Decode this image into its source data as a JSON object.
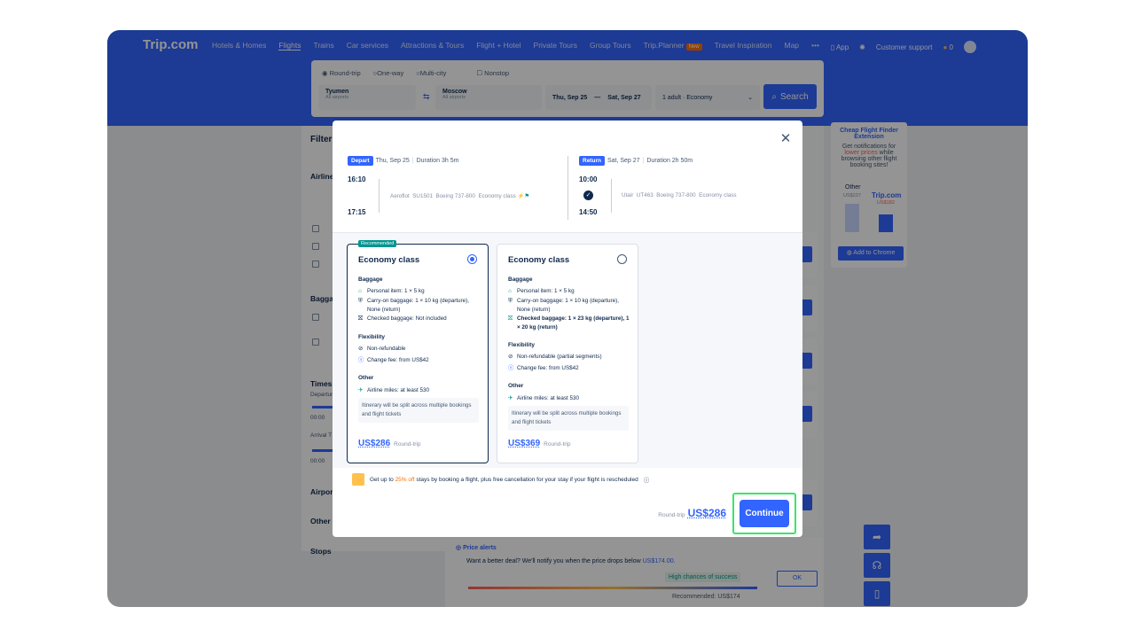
{
  "header": {
    "logo": "Trip.com",
    "nav": [
      "Hotels & Homes",
      "Flights",
      "Trains",
      "Car services",
      "Attractions & Tours",
      "Flight + Hotel",
      "Private Tours",
      "Group Tours",
      "Trip.Planner",
      "Travel Inspiration",
      "Map",
      "•••"
    ],
    "nav_new": "New",
    "app": "App",
    "support": "Customer support",
    "coins": "0"
  },
  "search": {
    "trip_types": [
      "Round-trip",
      "One-way",
      "Multi-city"
    ],
    "nonstop": "Nonstop",
    "from_city": "Tyumen",
    "from_sub": "All airports",
    "to_city": "Moscow",
    "to_sub": "All airports",
    "depart_date": "Thu, Sep 25",
    "return_date": "Sat, Sep 27",
    "passengers": "1 adult · Economy",
    "search_btn": "Search"
  },
  "filters": {
    "title": "Filters",
    "airlines": "Airlines",
    "baggage": "Baggage",
    "times": "Times",
    "departure": "Departure",
    "arrival": "Arrival T",
    "t1": "00:00",
    "t2": "00:00",
    "airports": "Airports",
    "other": "Other",
    "stops": "Stops"
  },
  "extension": {
    "title": "Cheap Flight Finder Extension",
    "desc1": "Get notifications for",
    "desc_hl": "lower prices",
    "desc2": "while browsing other flight booking sites!",
    "other": "Other",
    "other_price": "US$237",
    "trip": "Trip.com",
    "trip_price": "US$182",
    "btn": "Add to Chrome"
  },
  "price_alert": {
    "title": "Price alerts",
    "text": "Want a better deal? We'll notify you when the price drops below",
    "price": "US$174.00.",
    "chance": "High chances of success",
    "ok": "OK",
    "recommended": "Recommended: US$174"
  },
  "modal": {
    "depart": {
      "tag": "Depart",
      "date": "Thu, Sep 25",
      "duration": "Duration 3h 5m",
      "dep_time": "16:10",
      "arr_time": "17:15",
      "airline": "Aeroflot",
      "flight": "SU1501",
      "aircraft": "Boeing 737-800",
      "cabin": "Economy class"
    },
    "return": {
      "tag": "Return",
      "date": "Sat, Sep 27",
      "duration": "Duration 2h 50m",
      "dep_time": "10:00",
      "arr_time": "14:50",
      "airline": "Utair",
      "flight": "UT463",
      "aircraft": "Boeing 737-800",
      "cabin": "Economy class"
    },
    "options": [
      {
        "recommended": "Recommended",
        "title": "Economy class",
        "baggage": "Baggage",
        "personal": "Personal item: 1 × 5 kg",
        "carryon": "Carry-on baggage: 1 × 10 kg (departure), None (return)",
        "checked": "Checked baggage: Not included",
        "flexibility": "Flexibility",
        "refund": "Non-refundable",
        "change": "Change fee: from US$42",
        "other": "Other",
        "miles": "Airline miles: at least 530",
        "note": "Itinerary will be split across multiple bookings and flight tickets",
        "price": "US$286",
        "price_note": "Round-trip"
      },
      {
        "title": "Economy class",
        "baggage": "Baggage",
        "personal": "Personal item: 1 × 5 kg",
        "carryon": "Carry-on baggage: 1 × 10 kg (departure), None (return)",
        "checked": "Checked baggage: 1 × 23 kg (departure), 1 × 20 kg (return)",
        "flexibility": "Flexibility",
        "refund": "Non-refundable (partial segments)",
        "change": "Change fee: from US$42",
        "other": "Other",
        "miles": "Airline miles: at least 530",
        "note": "Itinerary will be split across multiple bookings and flight tickets",
        "price": "US$369",
        "price_note": "Round-trip"
      }
    ],
    "promo_pre": "Get up to",
    "promo_hl": "25% off",
    "promo_post": "stays by booking a flight, plus free cancellation for your stay if your flight is rescheduled",
    "total_label": "Round-trip",
    "total": "US$286",
    "continue": "Continue"
  },
  "colors": {
    "brand": "#3264ff",
    "recommended": "#00958f",
    "highlight": "#3be36a"
  }
}
